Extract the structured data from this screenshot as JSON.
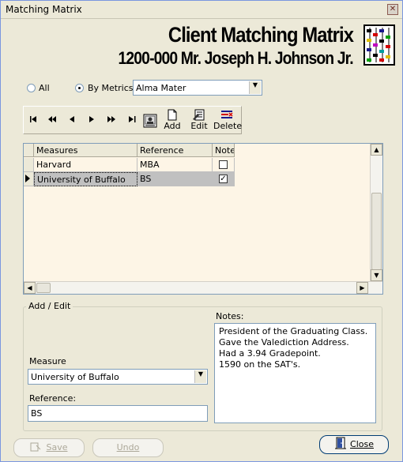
{
  "window": {
    "title": "Matching Matrix"
  },
  "header": {
    "title": "Client Matching Matrix",
    "client": "1200-000 Mr. Joseph H. Johnson Jr."
  },
  "filter": {
    "all_label": "All",
    "by_metrics_label": "By Metrics",
    "selected_option": "By Metrics",
    "metric_value": "Alma Mater"
  },
  "toolbar": {
    "add_label": "Add",
    "edit_label": "Edit",
    "delete_label": "Delete"
  },
  "grid": {
    "columns": [
      "Measures",
      "Reference",
      "Note"
    ],
    "rows": [
      {
        "measure": "Harvard",
        "reference": "MBA",
        "note": false
      },
      {
        "measure": "University of Buffalo",
        "reference": "BS",
        "note": true
      }
    ],
    "selected_row": 1
  },
  "add_edit": {
    "group_label": "Add / Edit",
    "measure_label": "Measure",
    "measure_value": "University of Buffalo",
    "reference_label": "Reference:",
    "reference_value": "BS",
    "notes_label": "Notes:",
    "notes_lines": [
      "President of the Graduating Class.",
      "Gave the Valediction Address.",
      "Had a 3.94 Gradepoint.",
      "1590 on the SAT's."
    ]
  },
  "buttons": {
    "save_label": "Save",
    "undo_label": "Undo",
    "close_label": "Close"
  },
  "colors": {
    "grid_background": "#fdf5e6",
    "selected_row": "#c0c0c0",
    "window_background": "#ece9d8"
  }
}
